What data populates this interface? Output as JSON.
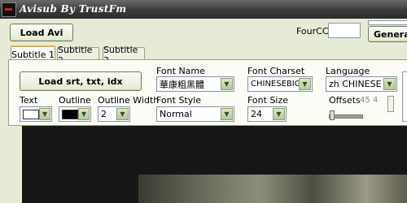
{
  "window": {
    "title": "Avisub By TrustFm"
  },
  "toolbar": {
    "load_avi_label": "Load Avi",
    "fourcc_label": "FourCC",
    "fourcc_value": "",
    "generate_label": "Genera"
  },
  "tabs": [
    {
      "label": "Subtitle 1",
      "active": true
    },
    {
      "label": "Subtitle 2",
      "active": false
    },
    {
      "label": "Subtitle 3",
      "active": false
    }
  ],
  "subtitle": {
    "load_srt_label": "Load srt, txt, idx",
    "font_name_label": "Font Name",
    "font_name_value": "華康粗黑體",
    "font_charset_label": "Font Charset",
    "font_charset_value": "CHINESEBIG",
    "language_label": "Language",
    "language_value": "zh CHINESE",
    "text_label": "Text",
    "outline_label": "Outline",
    "outline_width_label": "Outline Width",
    "outline_width_value": "2",
    "font_style_label": "Font Style",
    "font_style_value": "Normal",
    "font_size_label": "Font Size",
    "font_size_value": "24",
    "offsets_label": "Offsets",
    "offset_x": "45",
    "offset_y": "4",
    "text_color": "#ffffff",
    "outline_color": "#000000"
  }
}
